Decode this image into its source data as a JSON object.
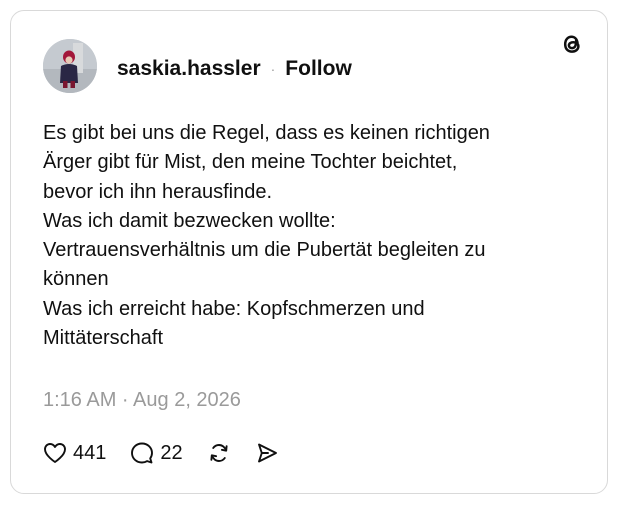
{
  "post": {
    "username": "saskia.hassler",
    "separator": "·",
    "follow_label": "Follow",
    "text_lines": [
      "Es gibt bei uns die Regel, dass es keinen richtigen",
      "Ärger gibt für Mist, den meine Tochter beichtet,",
      "bevor ich ihn herausfinde.",
      "Was ich damit bezwecken wollte:",
      "Vertrauensverhältnis um die Pubertät begleiten zu",
      "können",
      "Was ich erreicht habe: Kopfschmerzen und",
      "Mittäterschaft"
    ],
    "timestamp": "1:16 AM · Aug 2, 2026",
    "likes": "441",
    "replies": "22"
  },
  "icons": {
    "logo": "threads-logo-icon",
    "like": "heart-icon",
    "reply": "speech-bubble-icon",
    "repost": "repost-icon",
    "share": "send-icon"
  },
  "colors": {
    "text": "#101010",
    "muted": "#9a9a9a",
    "border": "#d9d9d9"
  }
}
